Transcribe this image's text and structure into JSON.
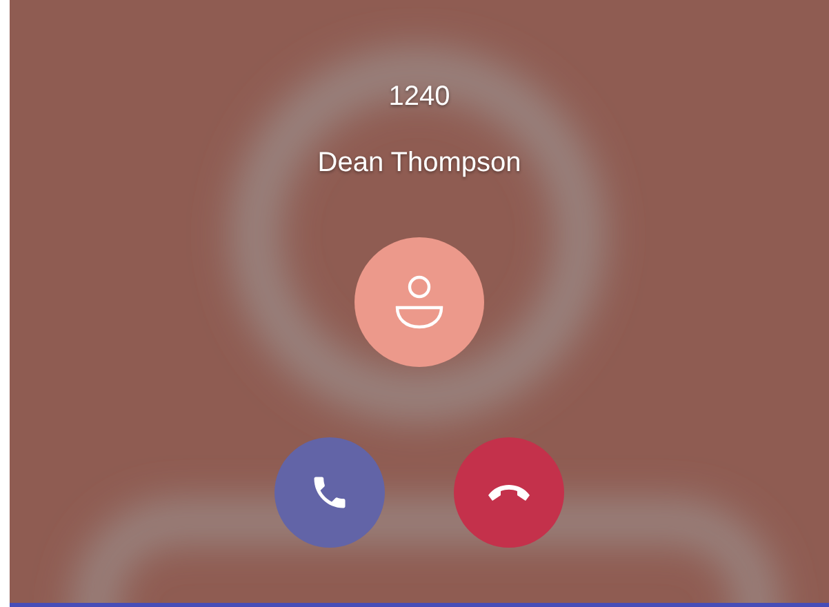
{
  "call": {
    "number": "1240",
    "name": "Dean Thompson"
  },
  "actions": [
    {
      "kind": "accept"
    },
    {
      "kind": "decline"
    }
  ]
}
